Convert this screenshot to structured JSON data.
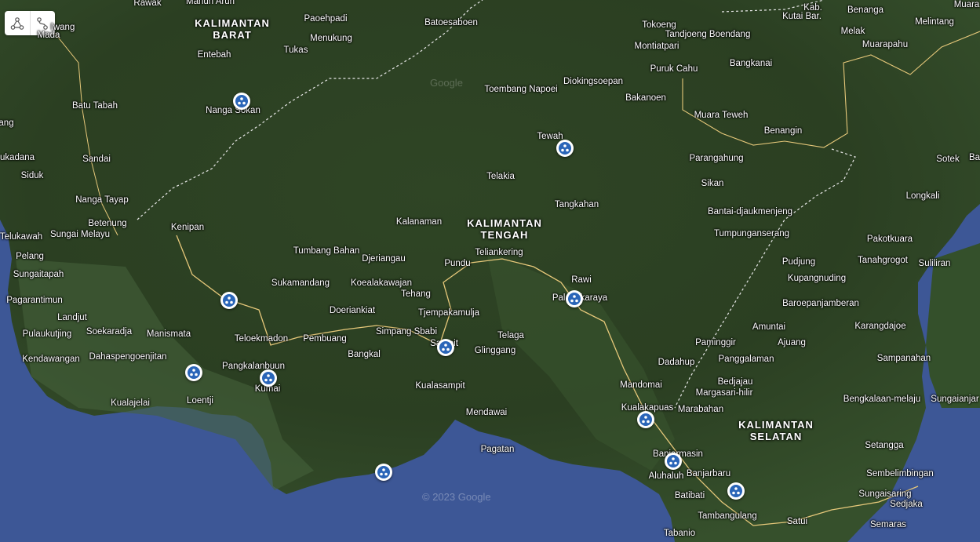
{
  "map": {
    "type": "satellite",
    "colors": {
      "sea": "#3d5796",
      "land": "#2e4426",
      "border": "#e8e8e8",
      "road": "#e6c87a",
      "pin_fill": "#2a65b8"
    },
    "attribution_center": "© 2023 Google",
    "attribution_top": "Google"
  },
  "toolbar": {
    "tools": [
      {
        "icon": "connect-nodes-icon"
      },
      {
        "icon": "path-line-icon"
      }
    ]
  },
  "regions": [
    {
      "id": "kalimantan-barat",
      "lines": [
        "KALIMANTAN",
        "BARAT"
      ]
    },
    {
      "id": "kalimantan-tengah",
      "lines": [
        "KALIMANTAN",
        "TENGAH"
      ]
    },
    {
      "id": "kalimantan-selatan",
      "lines": [
        "KALIMANTAN",
        "SELATAN"
      ]
    }
  ],
  "places": [
    "Rawak",
    "Manuh Aruh",
    "Paoehpadi",
    "Menukung",
    "Tukas",
    "Entebah",
    "Batoesaboen",
    "Nanga Sokan",
    "Batu Tabah",
    "Sandai",
    "Siduk",
    "Nanga Tayap",
    "Betenung",
    "Kenipan",
    "Sungai Melayu",
    "Telukawah",
    "Pelang",
    "Sungaitapah",
    "Pagarantimun",
    "Landjut",
    "Pulaukutjing",
    "Soekaradja",
    "Manismata",
    "Kendawangan",
    "Dahaspengoenjitan",
    "Kualajelai",
    "Loentji",
    "Pangkalanbuun",
    "Kumai",
    "Teloekmadon",
    "Pembuang",
    "Tumbang Bahan",
    "Djeriangau",
    "Kalanaman",
    "Sukamandang",
    "Koealakawajan",
    "Tehang",
    "Doeriankiat",
    "Simpang Sbabi",
    "Bangkal",
    "Sampit",
    "Pundu",
    "Teliankering",
    "Tjempakamulja",
    "Telaga",
    "Glinggang",
    "Kualasampit",
    "Mendawai",
    "Pagatan",
    "Toembang Napoei",
    "Diokingsoepan",
    "Tewah",
    "Telakia",
    "Tangkahan",
    "Rawi",
    "Palangkaraya",
    "Tokoeng",
    "Montiatpari",
    "Tandjoeng Boendang",
    "Puruk Cahu",
    "Bakanoen",
    "Bangkanai",
    "Muara Teweh",
    "Benangin",
    "Parangahung",
    "Sikan",
    "Bantai-djaukmenjeng",
    "Tumpunganserang",
    "Pudjung",
    "Kupangnuding",
    "Baroepanjamberan",
    "Amuntai",
    "Paminggir",
    "Ajuang",
    "Dadahup",
    "Panggalaman",
    "Bedjajau",
    "Margasari-hilir",
    "Mandomai",
    "Kualakapuas",
    "Marabahan",
    "Banjarmasin",
    "Aluhaluh",
    "Banjarbaru",
    "Batibati",
    "Tambangulang",
    "Tabanio",
    "Satui",
    "Kab.",
    "Kutai Bar.",
    "Benanga",
    "Melintang",
    "Melak",
    "Muarapahu",
    "Sotek",
    "Longkali",
    "Pakotkuara",
    "Tanahgrogot",
    "Suliliran",
    "Karangdajoe",
    "Sampanahan",
    "Bengkalaan-melaju",
    "Sungaianjar",
    "Setangga",
    "Sembelimbingan",
    "Sungaisaring",
    "Sedjaka",
    "Semaras",
    "Muara",
    "Mada",
    "Iwang",
    "ang",
    "ukadana",
    "Ba"
  ],
  "markers": [
    {
      "name": "marker-nanga-sokan"
    },
    {
      "name": "marker-tewah"
    },
    {
      "name": "marker-kenipan"
    },
    {
      "name": "marker-palangkaraya"
    },
    {
      "name": "marker-sampit"
    },
    {
      "name": "marker-manismata"
    },
    {
      "name": "marker-kumai"
    },
    {
      "name": "marker-kualakapuas"
    },
    {
      "name": "marker-banjarmasin"
    },
    {
      "name": "marker-pagatan-coast"
    },
    {
      "name": "marker-banjarbaru"
    }
  ]
}
